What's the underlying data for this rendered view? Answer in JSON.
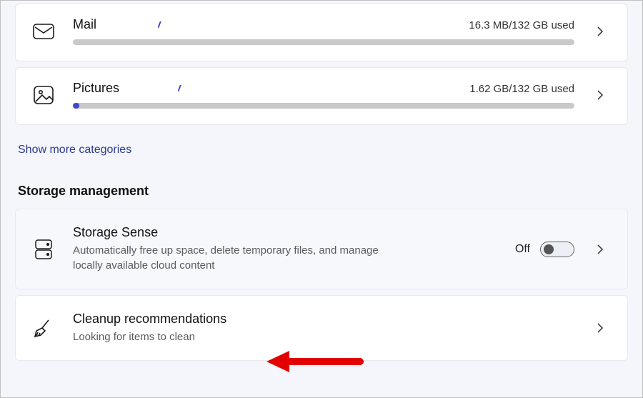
{
  "categories": [
    {
      "title": "Mail",
      "usage": "16.3 MB/132 GB used",
      "fill_percent": 0
    },
    {
      "title": "Pictures",
      "usage": "1.62 GB/132 GB used",
      "fill_percent": 1.3
    }
  ],
  "show_more": "Show more categories",
  "section_heading": "Storage management",
  "storage_sense": {
    "title": "Storage Sense",
    "subtitle": "Automatically free up space, delete temporary files, and manage locally available cloud content",
    "state": "Off"
  },
  "cleanup": {
    "title": "Cleanup recommendations",
    "subtitle": "Looking for items to clean"
  }
}
